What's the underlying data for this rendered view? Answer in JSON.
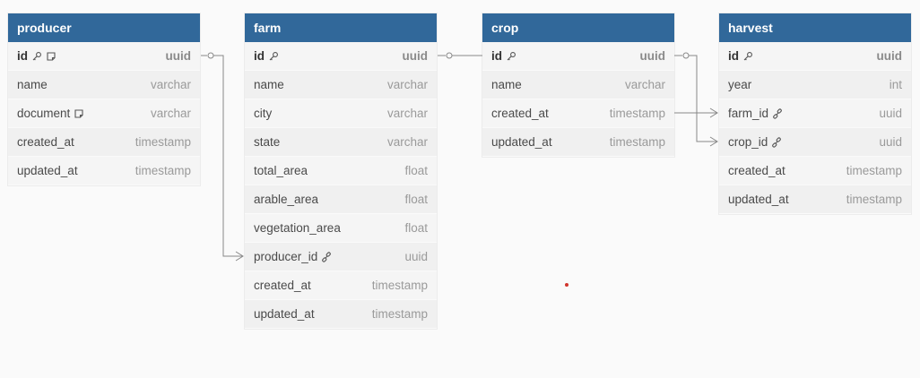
{
  "tables": [
    {
      "name": "producer",
      "columns": [
        {
          "name": "id",
          "type": "uuid",
          "pk": true,
          "icons": [
            "key-icon",
            "note-icon"
          ]
        },
        {
          "name": "name",
          "type": "varchar"
        },
        {
          "name": "document",
          "type": "varchar",
          "icons": [
            "note-icon"
          ]
        },
        {
          "name": "created_at",
          "type": "timestamp"
        },
        {
          "name": "updated_at",
          "type": "timestamp"
        }
      ]
    },
    {
      "name": "farm",
      "columns": [
        {
          "name": "id",
          "type": "uuid",
          "pk": true,
          "icons": [
            "key-icon"
          ]
        },
        {
          "name": "name",
          "type": "varchar"
        },
        {
          "name": "city",
          "type": "varchar"
        },
        {
          "name": "state",
          "type": "varchar"
        },
        {
          "name": "total_area",
          "type": "float"
        },
        {
          "name": "arable_area",
          "type": "float"
        },
        {
          "name": "vegetation_area",
          "type": "float"
        },
        {
          "name": "producer_id",
          "type": "uuid",
          "icons": [
            "link-icon"
          ]
        },
        {
          "name": "created_at",
          "type": "timestamp"
        },
        {
          "name": "updated_at",
          "type": "timestamp"
        }
      ]
    },
    {
      "name": "crop",
      "columns": [
        {
          "name": "id",
          "type": "uuid",
          "pk": true,
          "icons": [
            "key-icon"
          ]
        },
        {
          "name": "name",
          "type": "varchar"
        },
        {
          "name": "created_at",
          "type": "timestamp"
        },
        {
          "name": "updated_at",
          "type": "timestamp"
        }
      ]
    },
    {
      "name": "harvest",
      "columns": [
        {
          "name": "id",
          "type": "uuid",
          "pk": true,
          "icons": [
            "key-icon"
          ]
        },
        {
          "name": "year",
          "type": "int"
        },
        {
          "name": "farm_id",
          "type": "uuid",
          "icons": [
            "link-icon"
          ]
        },
        {
          "name": "crop_id",
          "type": "uuid",
          "icons": [
            "link-icon"
          ]
        },
        {
          "name": "created_at",
          "type": "timestamp"
        },
        {
          "name": "updated_at",
          "type": "timestamp"
        }
      ]
    }
  ],
  "relationships": [
    {
      "from": "producer.id",
      "to": "farm.producer_id"
    },
    {
      "from": "farm.id",
      "to": "crop.id"
    },
    {
      "from": "crop.id",
      "to": "harvest.crop_id"
    },
    {
      "from": "crop.created_at",
      "to": "harvest.farm_id"
    }
  ],
  "colors": {
    "header_bg": "#31689a",
    "line": "#888888"
  }
}
